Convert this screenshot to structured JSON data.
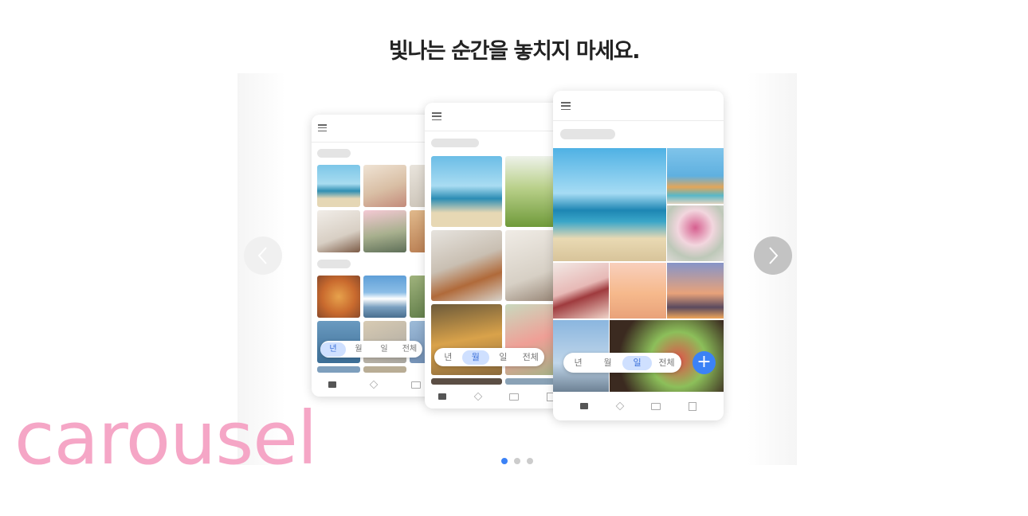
{
  "headline": "빛나는 순간을 놓치지 마세요.",
  "watermark": "carousel",
  "carousel": {
    "prev_icon": "chevron-left-icon",
    "next_icon": "chevron-right-icon",
    "dots": 3,
    "active_index": 0
  },
  "phones": [
    {
      "filter": [
        "년",
        "월",
        "일",
        "전체"
      ],
      "active": "년"
    },
    {
      "filter": [
        "년",
        "월",
        "일",
        "전체"
      ],
      "active": "월"
    },
    {
      "filter": [
        "년",
        "월",
        "일",
        "전체"
      ],
      "active": "일"
    }
  ],
  "fab": {
    "label": "+",
    "icon": "plus-icon"
  },
  "colors": {
    "accent": "#3b82f6",
    "active_pill": "#cfe0ff",
    "watermark": "#f5a6c6"
  }
}
